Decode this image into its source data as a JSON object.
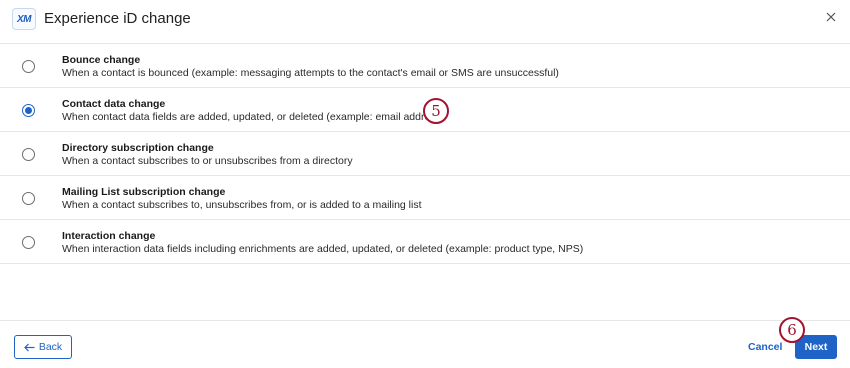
{
  "header": {
    "logo_text": "XM",
    "title": "Experience iD change"
  },
  "options": [
    {
      "title": "Bounce change",
      "description": "When a contact is bounced (example: messaging attempts to the contact's email or SMS are unsuccessful)",
      "selected": false
    },
    {
      "title": "Contact data change",
      "description": "When contact data fields are added, updated, or deleted (example: email address)",
      "selected": true
    },
    {
      "title": "Directory subscription change",
      "description": "When a contact subscribes to or unsubscribes from a directory",
      "selected": false
    },
    {
      "title": "Mailing List subscription change",
      "description": "When a contact subscribes to, unsubscribes from, or is added to a mailing list",
      "selected": false
    },
    {
      "title": "Interaction change",
      "description": "When interaction data fields including enrichments are added, updated, or deleted (example: product type, NPS)",
      "selected": false
    }
  ],
  "annotations": {
    "step_5": "5",
    "step_6": "6"
  },
  "footer": {
    "back_label": "Back",
    "cancel_label": "Cancel",
    "next_label": "Next"
  },
  "colors": {
    "accent": "#1f63c6",
    "annotation": "#a3122e"
  }
}
